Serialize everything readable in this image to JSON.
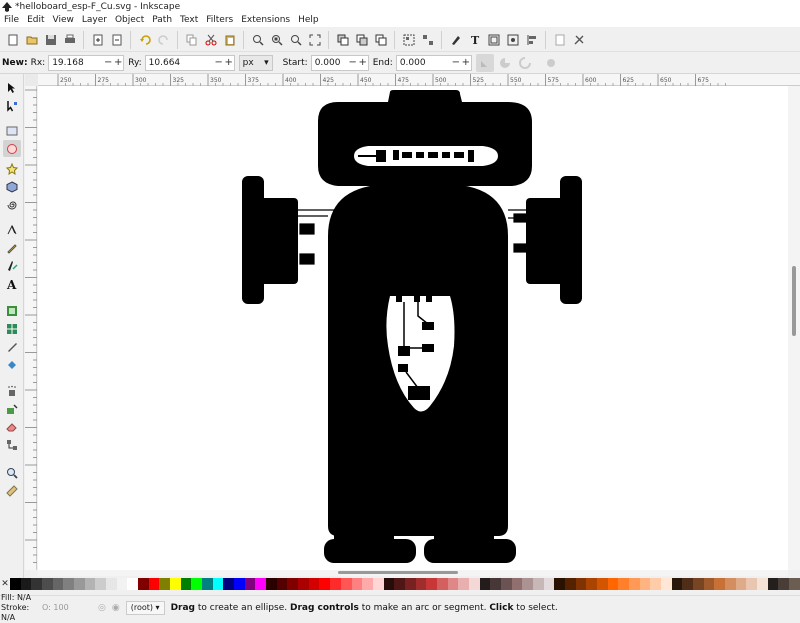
{
  "window": {
    "title": "*helloboard_esp-F_Cu.svg - Inkscape"
  },
  "menu": [
    "File",
    "Edit",
    "View",
    "Layer",
    "Object",
    "Path",
    "Text",
    "Filters",
    "Extensions",
    "Help"
  ],
  "context_bar": {
    "new_label": "New:",
    "rx_label": "Rx:",
    "rx_value": "19.168",
    "ry_label": "Ry:",
    "ry_value": "10.664",
    "unit": "px",
    "start_label": "Start:",
    "start_value": "0.000",
    "end_label": "End:",
    "end_value": "0.000",
    "minus": "−",
    "plus": "+"
  },
  "ruler": {
    "ticks": [
      "250",
      "275",
      "300",
      "325",
      "350",
      "375",
      "400",
      "425",
      "450",
      "475",
      "500",
      "525",
      "550",
      "575",
      "600",
      "625",
      "650",
      "675"
    ]
  },
  "tools": [
    "selector-tool",
    "node-tool",
    "rectangle-tool",
    "ellipse-tool",
    "star-tool",
    "3d-box-tool",
    "spiral-tool",
    "pen-tool",
    "pencil-tool",
    "calligraphy-tool",
    "text-tool",
    "gradient-tool",
    "mesh-tool",
    "dropper-tool",
    "paint-bucket-tool",
    "spray-tool",
    "tweak-tool",
    "eraser-tool",
    "connector-tool",
    "zoom-tool",
    "measure-tool"
  ],
  "palette": {
    "colors": [
      "#000000",
      "#1a1a1a",
      "#333333",
      "#4d4d4d",
      "#666666",
      "#808080",
      "#999999",
      "#b3b3b3",
      "#cccccc",
      "#e6e6e6",
      "#f2f2f2",
      "#ffffff",
      "#800000",
      "#ff0000",
      "#808000",
      "#ffff00",
      "#008000",
      "#00ff00",
      "#008080",
      "#00ffff",
      "#000080",
      "#0000ff",
      "#800080",
      "#ff00ff",
      "#2b0000",
      "#550000",
      "#800000",
      "#aa0000",
      "#d40000",
      "#ff0000",
      "#ff2a2a",
      "#ff5555",
      "#ff8080",
      "#ffaaaa",
      "#ffd5d5",
      "#280b0b",
      "#501616",
      "#782121",
      "#a02c2c",
      "#c83737",
      "#d35f5f",
      "#de8787",
      "#e9afaf",
      "#f4d7d7",
      "#241c1c",
      "#483737",
      "#6c5353",
      "#916f6f",
      "#ac9393",
      "#c8b7b7",
      "#e3dbdb",
      "#2b1100",
      "#552200",
      "#803300",
      "#aa4400",
      "#d45500",
      "#ff6600",
      "#ff7f2a",
      "#ff9955",
      "#ffb380",
      "#ffccaa",
      "#ffe6d5",
      "#28170b",
      "#502d16",
      "#784421",
      "#a05a2c",
      "#c87137",
      "#d38d5f",
      "#deaa87",
      "#e9c6af",
      "#f4e3d7",
      "#241f1c",
      "#483e37",
      "#6c5d53"
    ]
  },
  "status": {
    "fill_label": "Fill:",
    "fill_value": "N/A",
    "stroke_label": "Stroke:",
    "stroke_value": "N/A",
    "opacity_label": "O:",
    "opacity_value": "100",
    "layer": "(root)",
    "msg_drag": "Drag",
    "msg_1": " to create an ellipse. ",
    "msg_controls": "Drag controls",
    "msg_2": " to make an arc or segment. ",
    "msg_click": "Click",
    "msg_3": " to select."
  }
}
